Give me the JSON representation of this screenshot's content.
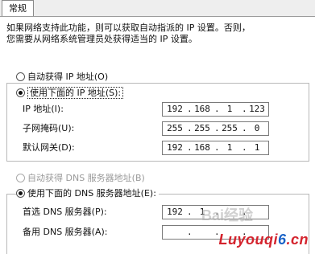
{
  "tab": {
    "label": "常规"
  },
  "description": "如果网络支持此功能，则可以获取自动指派的 IP 设置。否则，\n您需要从网络系统管理员处获得适当的 IP 设置。",
  "ip_group": {
    "auto_option": "自动获得 IP 地址(O)",
    "manual_option": "使用下面的 IP 地址(S):",
    "ip_label": "IP 地址(I):",
    "ip_value": [
      "192",
      "168",
      "1",
      "123"
    ],
    "subnet_label": "子网掩码(U):",
    "subnet_value": [
      "255",
      "255",
      "255",
      "0"
    ],
    "gateway_label": "默认网关(D):",
    "gateway_value": [
      "192",
      "168",
      "1",
      "1"
    ]
  },
  "dns_group": {
    "auto_option": "自动获得 DNS 服务器地址(B)",
    "manual_option": "使用下面的 DNS 服务器地址(E):",
    "preferred_label": "首选 DNS 服务器(P):",
    "preferred_value": [
      "192",
      "1",
      "",
      ""
    ],
    "alternate_label": "备用 DNS 服务器(A):",
    "alternate_value": [
      "",
      "",
      "",
      ""
    ]
  },
  "watermark": {
    "main": "Luyouqi",
    "num": "6",
    "domain": ".cn",
    "overlay": "Bai经验"
  }
}
